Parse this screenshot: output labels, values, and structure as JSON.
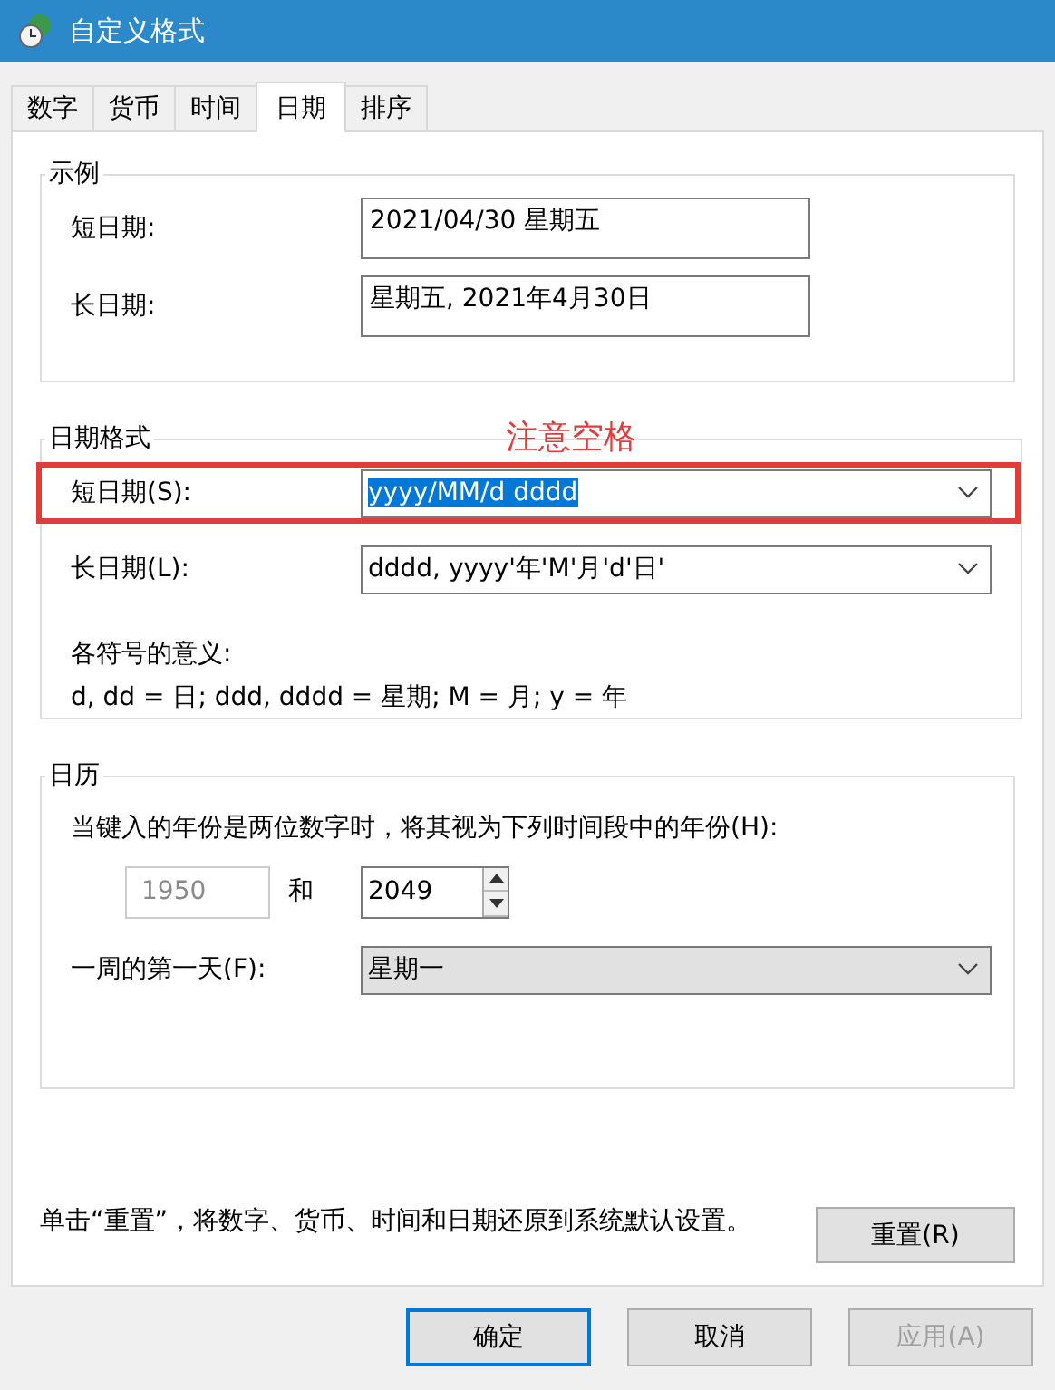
{
  "window": {
    "title": "自定义格式"
  },
  "tabs": [
    {
      "label": "数字",
      "selected": false
    },
    {
      "label": "货币",
      "selected": false
    },
    {
      "label": "时间",
      "selected": false
    },
    {
      "label": "日期",
      "selected": true
    },
    {
      "label": "排序",
      "selected": false
    }
  ],
  "example": {
    "title": "示例",
    "rows": [
      {
        "label": "短日期:",
        "value": "2021/04/30 星期五"
      },
      {
        "label": "长日期:",
        "value": "星期五, 2021年4月30日"
      }
    ]
  },
  "date_format": {
    "title": "日期格式",
    "annotation": "注意空格",
    "rows": [
      {
        "label": "短日期(S):",
        "value": "yyyy/MM/d dddd",
        "text_selected": true,
        "highlighted": true
      },
      {
        "label": "长日期(L):",
        "value": "dddd, yyyy'年'M'月'd'日'",
        "text_selected": false,
        "highlighted": false
      }
    ],
    "legend_title": "各符号的意义:",
    "legend": "d, dd = 日;  ddd, dddd = 星期;  M = 月;  y = 年"
  },
  "calendar": {
    "title": "日历",
    "two_digit_label": "当键入的年份是两位数字时，将其视为下列时间段中的年份(H):",
    "from": {
      "value": "1950",
      "disabled": true
    },
    "and": "和",
    "to": {
      "value": "2049"
    },
    "first_day": {
      "label": "一周的第一天(F):",
      "value": "星期一"
    }
  },
  "reset": {
    "text": "单击“重置”，将数字、货币、时间和日期还原到系统默认设置。",
    "button": "重置(R)"
  },
  "buttons": [
    {
      "label": "确定",
      "default": true,
      "disabled": false
    },
    {
      "label": "取消",
      "default": false,
      "disabled": false
    },
    {
      "label": "应用(A)",
      "default": false,
      "disabled": true
    }
  ]
}
